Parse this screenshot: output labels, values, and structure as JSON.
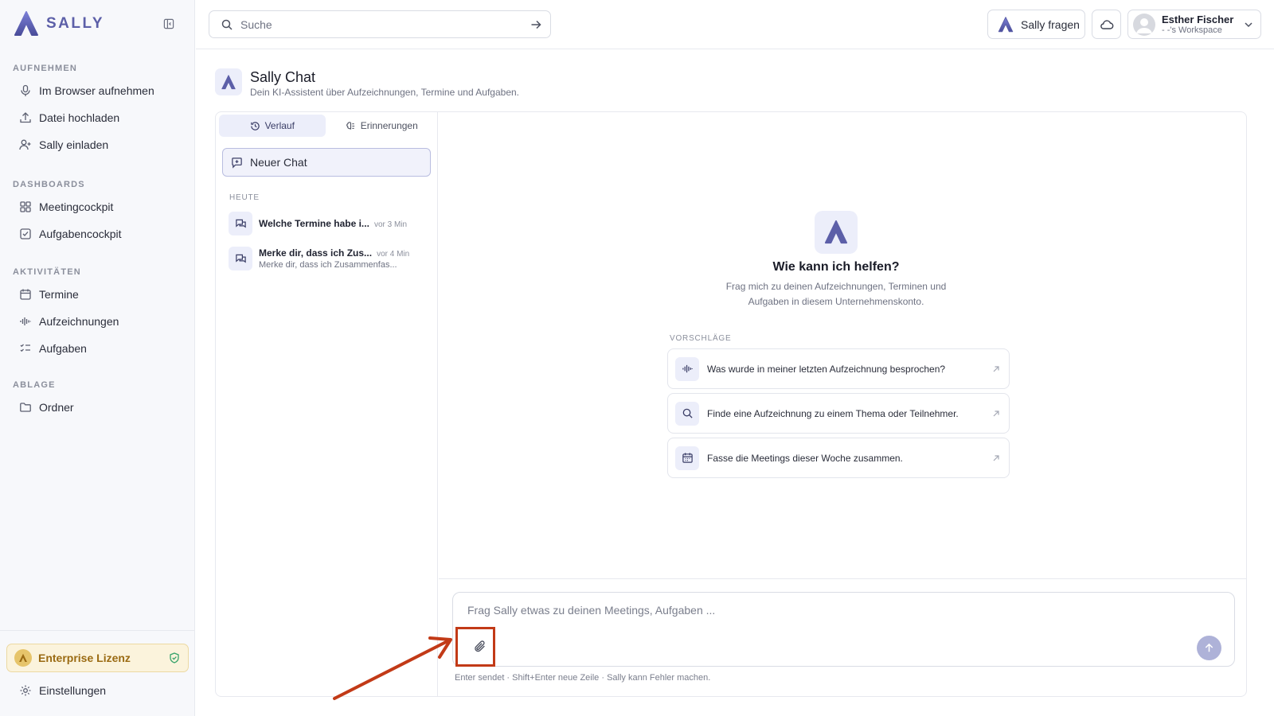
{
  "app": {
    "name": "SALLY",
    "brand_color": "#5c5fa8"
  },
  "sidebar": {
    "sections": [
      {
        "title": "AUFNEHMEN",
        "items": [
          {
            "label": "Im Browser aufnehmen",
            "icon": "microphone-icon"
          },
          {
            "label": "Datei hochladen",
            "icon": "upload-icon"
          },
          {
            "label": "Sally einladen",
            "icon": "user-plus-icon"
          }
        ]
      },
      {
        "title": "DASHBOARDS",
        "items": [
          {
            "label": "Meetingcockpit",
            "icon": "grid-icon"
          },
          {
            "label": "Aufgabencockpit",
            "icon": "checkbox-icon"
          }
        ]
      },
      {
        "title": "AKTIVITÄTEN",
        "items": [
          {
            "label": "Termine",
            "icon": "calendar-icon"
          },
          {
            "label": "Aufzeichnungen",
            "icon": "waveform-icon"
          },
          {
            "label": "Aufgaben",
            "icon": "list-check-icon"
          }
        ]
      },
      {
        "title": "ABLAGE",
        "items": [
          {
            "label": "Ordner",
            "icon": "folder-icon"
          }
        ]
      }
    ],
    "license_label": "Enterprise Lizenz",
    "settings_label": "Einstellungen"
  },
  "topbar": {
    "search_placeholder": "Suche",
    "ask_label": "Sally fragen",
    "user_name": "Esther Fischer",
    "workspace": "- -'s Workspace"
  },
  "page": {
    "title": "Sally Chat",
    "subtitle": "Dein KI-Assistent über Aufzeichnungen, Termine und Aufgaben."
  },
  "history": {
    "tabs": [
      {
        "label": "Verlauf",
        "active": true
      },
      {
        "label": "Erinnerungen",
        "active": false
      }
    ],
    "new_chat_label": "Neuer Chat",
    "group_label": "HEUTE",
    "chats": [
      {
        "title": "Welche Termine habe i...",
        "time": "vor 3 Min",
        "preview": ""
      },
      {
        "title": "Merke dir, dass ich Zus...",
        "time": "vor 4 Min",
        "preview": "Merke dir, dass ich Zusammenfas..."
      }
    ]
  },
  "welcome": {
    "title": "Wie kann ich helfen?",
    "text": "Frag mich zu deinen Aufzeichnungen, Terminen und Aufgaben in diesem Unternehmenskonto.",
    "suggestions_label": "VORSCHLÄGE",
    "suggestions": [
      {
        "label": "Was wurde in meiner letzten Aufzeichnung besprochen?",
        "icon": "waveform-icon"
      },
      {
        "label": "Finde eine Aufzeichnung zu einem Thema oder Teilnehmer.",
        "icon": "search-icon"
      },
      {
        "label": "Fasse die Meetings dieser Woche zusammen.",
        "icon": "calendar-icon"
      }
    ]
  },
  "composer": {
    "placeholder": "Frag Sally etwas zu deinen Meetings, Aufgaben ...",
    "hint": "Enter sendet · Shift+Enter neue Zeile · Sally kann Fehler machen."
  },
  "annotation": {
    "color": "#c23a17",
    "target": "attach-icon"
  }
}
